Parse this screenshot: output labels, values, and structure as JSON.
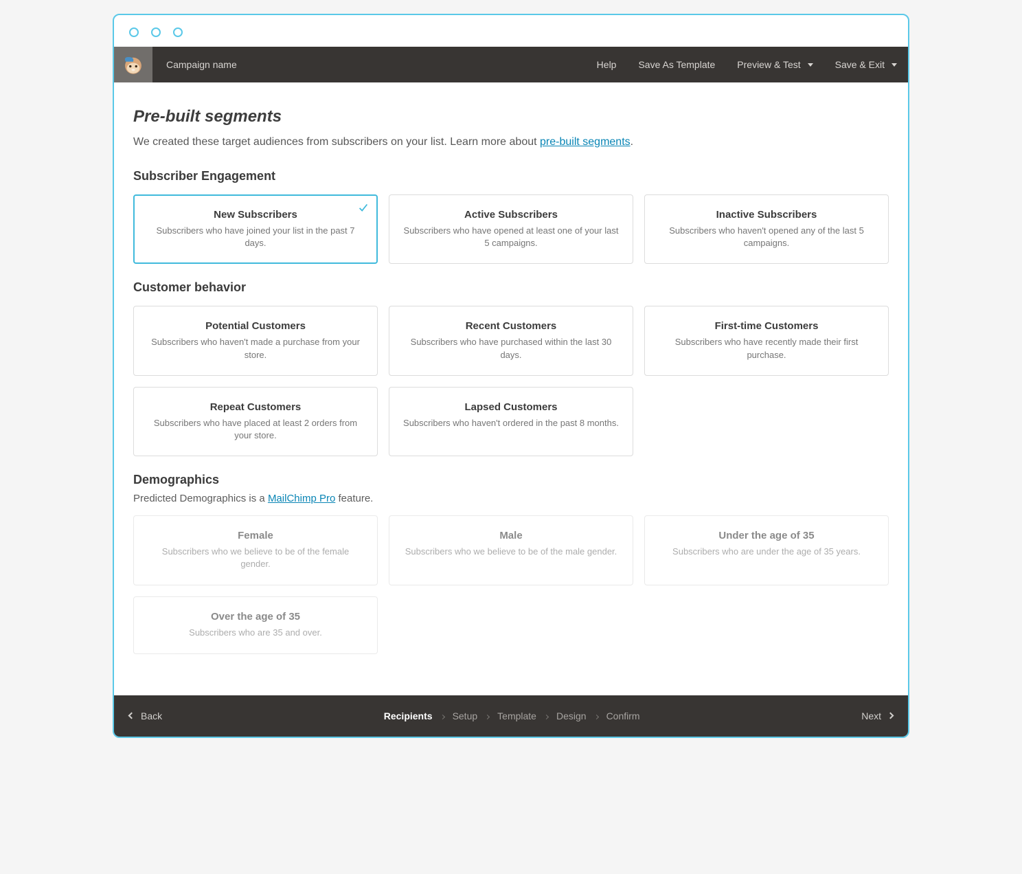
{
  "header": {
    "campaign_name": "Campaign name",
    "help": "Help",
    "save_template": "Save As Template",
    "preview_test": "Preview & Test",
    "save_exit": "Save & Exit"
  },
  "page": {
    "title": "Pre-built segments",
    "desc_prefix": "We created these target audiences from subscribers on your list. Learn more about ",
    "desc_link": "pre-built segments",
    "desc_suffix": "."
  },
  "sections": {
    "engagement": {
      "title": "Subscriber Engagement",
      "cards": [
        {
          "title": "New Subscribers",
          "desc": "Subscribers who have joined your list in the past 7 days.",
          "selected": true
        },
        {
          "title": "Active Subscribers",
          "desc": "Subscribers who have opened at least one of your last 5 campaigns."
        },
        {
          "title": "Inactive Subscribers",
          "desc": "Subscribers who haven't opened any of the last 5 campaigns."
        }
      ]
    },
    "behavior": {
      "title": "Customer behavior",
      "cards": [
        {
          "title": "Potential Customers",
          "desc": "Subscribers who haven't made a purchase from your store."
        },
        {
          "title": "Recent Customers",
          "desc": "Subscribers who have purchased within the last 30 days."
        },
        {
          "title": "First-time Customers",
          "desc": "Subscribers who have recently made their first purchase."
        },
        {
          "title": "Repeat Customers",
          "desc": "Subscribers who have placed at least 2 orders from your store."
        },
        {
          "title": "Lapsed Customers",
          "desc": "Subscribers who haven't ordered in the past 8 months."
        }
      ]
    },
    "demographics": {
      "title": "Demographics",
      "desc_prefix": "Predicted Demographics is a ",
      "desc_link": "MailChimp Pro",
      "desc_suffix": " feature.",
      "cards": [
        {
          "title": "Female",
          "desc": "Subscribers who we believe to be of the female gender.",
          "disabled": true
        },
        {
          "title": "Male",
          "desc": "Subscribers who we believe to be of the male gender.",
          "disabled": true
        },
        {
          "title": "Under the age of 35",
          "desc": "Subscribers who are under the age of 35 years.",
          "disabled": true
        },
        {
          "title": "Over the age of 35",
          "desc": "Subscribers who are 35 and over.",
          "disabled": true
        }
      ]
    }
  },
  "footer": {
    "back": "Back",
    "next": "Next",
    "steps": [
      "Recipients",
      "Setup",
      "Template",
      "Design",
      "Confirm"
    ],
    "active_step": 0
  }
}
